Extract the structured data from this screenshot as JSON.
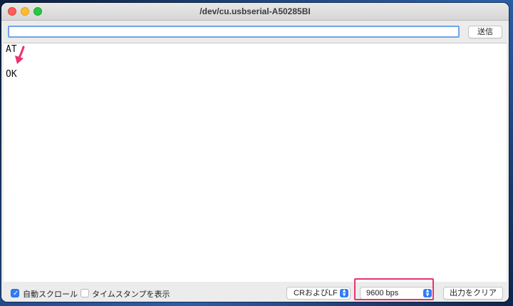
{
  "window": {
    "title": "/dev/cu.usbserial-A50285BI"
  },
  "toolbar": {
    "send_input_value": "",
    "send_label": "送信"
  },
  "output": {
    "lines": [
      "AT",
      "OK"
    ],
    "annotation": {
      "icon": "arrow-down-icon",
      "color": "#e8336f"
    }
  },
  "bottom": {
    "autoscroll_label": "自動スクロール",
    "autoscroll_checked": true,
    "timestamp_label": "タイムスタンプを表示",
    "timestamp_checked": false,
    "line_ending": "CRおよびLF",
    "baud_rate": "9600 bps",
    "clear_label": "出力をクリア",
    "highlight_color": "#e8336f"
  }
}
